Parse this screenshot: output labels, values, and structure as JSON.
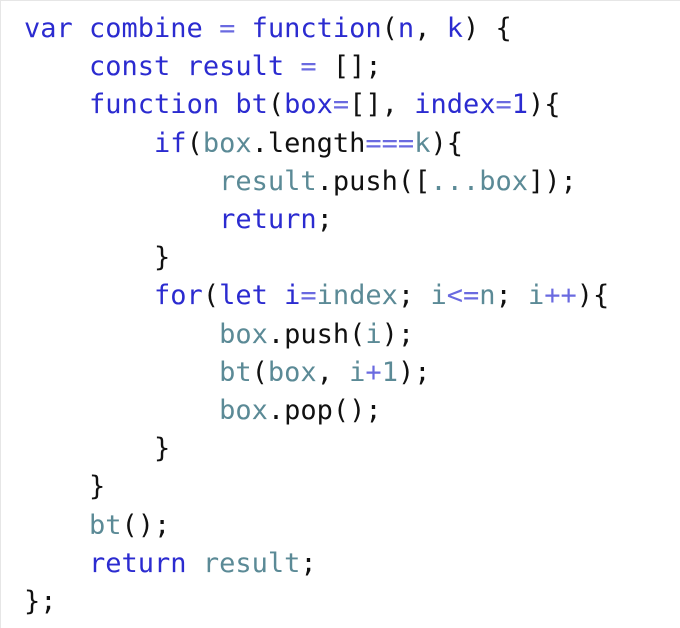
{
  "colors": {
    "keyword": "#2b2bd0",
    "variable": "#5b8a96",
    "operator": "#6a6ae0",
    "plain": "#111111",
    "background": "#ffffff"
  },
  "lines": [
    {
      "tokens": [
        [
          "kw",
          "var combine"
        ],
        [
          "pl",
          " "
        ],
        [
          "op",
          "="
        ],
        [
          "pl",
          " "
        ],
        [
          "kw",
          "function"
        ],
        [
          "pl",
          "("
        ],
        [
          "kw",
          "n"
        ],
        [
          "pl",
          ", "
        ],
        [
          "kw",
          "k"
        ],
        [
          "pl",
          ") {"
        ]
      ]
    },
    {
      "tokens": [
        [
          "pl",
          "    "
        ],
        [
          "kw",
          "const result"
        ],
        [
          "pl",
          " "
        ],
        [
          "op",
          "="
        ],
        [
          "pl",
          " [];"
        ]
      ]
    },
    {
      "tokens": [
        [
          "pl",
          "    "
        ],
        [
          "kw",
          "function bt"
        ],
        [
          "pl",
          "("
        ],
        [
          "kw",
          "box"
        ],
        [
          "op",
          "="
        ],
        [
          "pl",
          "[], "
        ],
        [
          "kw",
          "index"
        ],
        [
          "op",
          "="
        ],
        [
          "kw",
          "1"
        ],
        [
          "pl",
          "){"
        ]
      ]
    },
    {
      "tokens": [
        [
          "pl",
          "        "
        ],
        [
          "kw",
          "if"
        ],
        [
          "pl",
          "("
        ],
        [
          "var",
          "box"
        ],
        [
          "pl",
          "."
        ],
        [
          "pl",
          "length"
        ],
        [
          "op",
          "==="
        ],
        [
          "var",
          "k"
        ],
        [
          "pl",
          "){"
        ]
      ]
    },
    {
      "tokens": [
        [
          "pl",
          "            "
        ],
        [
          "var",
          "result"
        ],
        [
          "pl",
          ".push(["
        ],
        [
          "var",
          "..."
        ],
        [
          "var",
          "box"
        ],
        [
          "pl",
          "]);"
        ]
      ]
    },
    {
      "tokens": [
        [
          "pl",
          "            "
        ],
        [
          "kw",
          "return"
        ],
        [
          "pl",
          ";"
        ]
      ]
    },
    {
      "tokens": [
        [
          "pl",
          "        }"
        ]
      ]
    },
    {
      "tokens": [
        [
          "pl",
          "        "
        ],
        [
          "kw",
          "for"
        ],
        [
          "pl",
          "("
        ],
        [
          "kw",
          "let i"
        ],
        [
          "op",
          "="
        ],
        [
          "var",
          "index"
        ],
        [
          "pl",
          "; "
        ],
        [
          "var",
          "i"
        ],
        [
          "op",
          "<="
        ],
        [
          "var",
          "n"
        ],
        [
          "pl",
          "; "
        ],
        [
          "var",
          "i"
        ],
        [
          "op",
          "++"
        ],
        [
          "pl",
          "){"
        ]
      ]
    },
    {
      "tokens": [
        [
          "pl",
          "            "
        ],
        [
          "var",
          "box"
        ],
        [
          "pl",
          ".push("
        ],
        [
          "var",
          "i"
        ],
        [
          "pl",
          ");"
        ]
      ]
    },
    {
      "tokens": [
        [
          "pl",
          "            "
        ],
        [
          "var",
          "bt"
        ],
        [
          "pl",
          "("
        ],
        [
          "var",
          "box"
        ],
        [
          "pl",
          ", "
        ],
        [
          "var",
          "i"
        ],
        [
          "op",
          "+"
        ],
        [
          "var",
          "1"
        ],
        [
          "pl",
          ");"
        ]
      ]
    },
    {
      "tokens": [
        [
          "pl",
          "            "
        ],
        [
          "var",
          "box"
        ],
        [
          "pl",
          ".pop();"
        ]
      ]
    },
    {
      "tokens": [
        [
          "pl",
          "        }"
        ]
      ]
    },
    {
      "tokens": [
        [
          "pl",
          "    }"
        ]
      ]
    },
    {
      "tokens": [
        [
          "pl",
          "    "
        ],
        [
          "var",
          "bt"
        ],
        [
          "pl",
          "();"
        ]
      ]
    },
    {
      "tokens": [
        [
          "pl",
          "    "
        ],
        [
          "kw",
          "return"
        ],
        [
          "pl",
          " "
        ],
        [
          "var",
          "result"
        ],
        [
          "pl",
          ";"
        ]
      ]
    },
    {
      "tokens": [
        [
          "pl",
          "};"
        ]
      ]
    }
  ]
}
